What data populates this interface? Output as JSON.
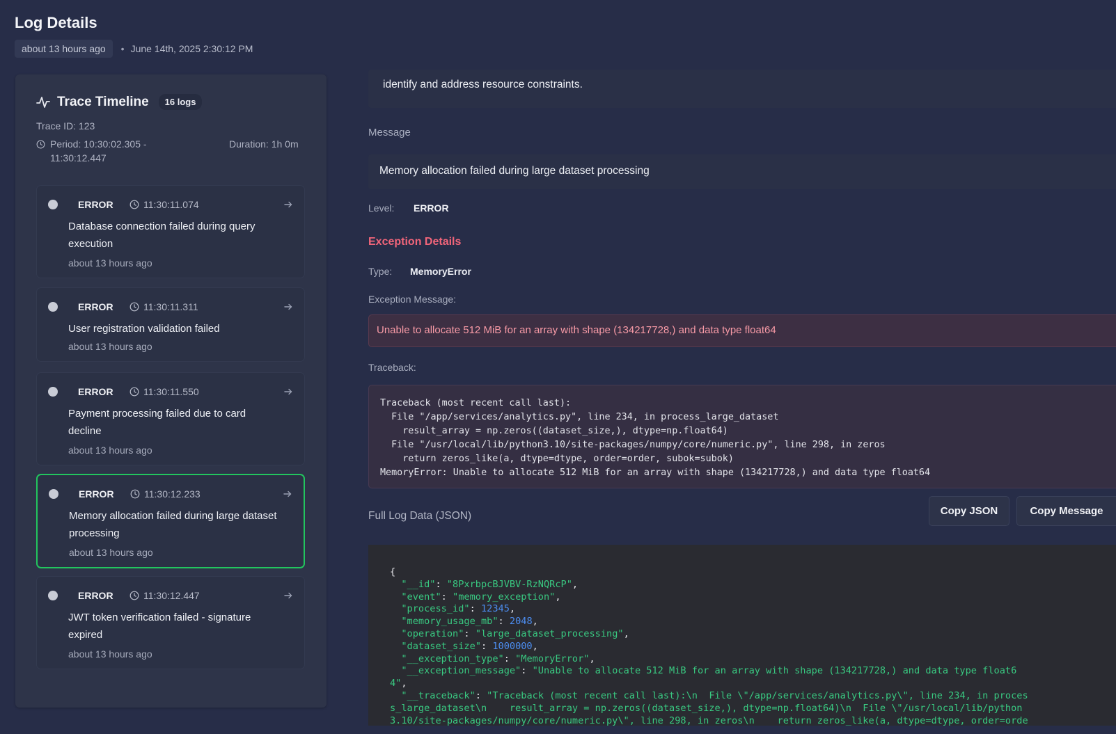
{
  "header": {
    "title": "Log Details",
    "relative_time": "about 13 hours ago",
    "timestamp": "June 14th, 2025 2:30:12 PM"
  },
  "timeline": {
    "title": "Trace Timeline",
    "badge": "16 logs",
    "trace_id": "Trace ID: 123",
    "period": "Period: 10:30:02.305 - 11:30:12.447",
    "duration": "Duration: 1h 0m",
    "logs": [
      {
        "level": "ERROR",
        "time": "11:30:11.074",
        "message": "Database connection failed during query execution",
        "ago": "about 13 hours ago",
        "selected": false
      },
      {
        "level": "ERROR",
        "time": "11:30:11.311",
        "message": "User registration validation failed",
        "ago": "about 13 hours ago",
        "selected": false
      },
      {
        "level": "ERROR",
        "time": "11:30:11.550",
        "message": "Payment processing failed due to card decline",
        "ago": "about 13 hours ago",
        "selected": false
      },
      {
        "level": "ERROR",
        "time": "11:30:12.233",
        "message": "Memory allocation failed during large dataset processing",
        "ago": "about 13 hours ago",
        "selected": true
      },
      {
        "level": "ERROR",
        "time": "11:30:12.447",
        "message": "JWT token verification failed - signature expired",
        "ago": "about 13 hours ago",
        "selected": false
      }
    ]
  },
  "details": {
    "description_tail": "identify and address resource constraints.",
    "message_label": "Message",
    "message": "Memory allocation failed during large dataset processing",
    "level_label": "Level:",
    "level": "ERROR",
    "exception_title": "Exception Details",
    "type_label": "Type:",
    "type": "MemoryError",
    "exception_message_label": "Exception Message:",
    "exception_message": "Unable to allocate 512 MiB for an array with shape (134217728,) and data type float64",
    "traceback_label": "Traceback:",
    "traceback": "Traceback (most recent call last):\n  File \"/app/services/analytics.py\", line 234, in process_large_dataset\n    result_array = np.zeros((dataset_size,), dtype=np.float64)\n  File \"/usr/local/lib/python3.10/site-packages/numpy/core/numeric.py\", line 298, in zeros\n    return zeros_like(a, dtype=dtype, order=order, subok=subok)\nMemoryError: Unable to allocate 512 MiB for an array with shape (134217728,) and data type float64",
    "json_label": "Full Log Data (JSON)",
    "copy_json_label": "Copy JSON",
    "copy_message_label": "Copy Message",
    "json_lines": [
      "{",
      "  \"__id\": \"8PxrbpcBJVBV-RzNQRcP\",",
      "  \"event\": \"memory_exception\",",
      "  \"process_id\": 12345,",
      "  \"memory_usage_mb\": 2048,",
      "  \"operation\": \"large_dataset_processing\",",
      "  \"dataset_size\": 1000000,",
      "  \"__exception_type\": \"MemoryError\",",
      "  \"__exception_message\": \"Unable to allocate 512 MiB for an array with shape (134217728,) and data type float6",
      "4\",",
      "  \"__traceback\": \"Traceback (most recent call last):\\n  File \\\"/app/services/analytics.py\\\", line 234, in proces",
      "s_large_dataset\\n    result_array = np.zeros((dataset_size,), dtype=np.float64)\\n  File \\\"/usr/local/lib/python",
      "3.10/site-packages/numpy/core/numeric.py\\\", line 298, in zeros\\n    return zeros_like(a, dtype=dtype, order=orde"
    ]
  },
  "colors": {
    "background": "#272d48",
    "selected_border": "#22c55e",
    "exception_accent": "#f1657a",
    "json_string": "#39c981",
    "json_number": "#4c8df0"
  },
  "icons": [
    "pulse-icon",
    "clock-icon",
    "arrow-right-icon",
    "status-dot-icon"
  ]
}
